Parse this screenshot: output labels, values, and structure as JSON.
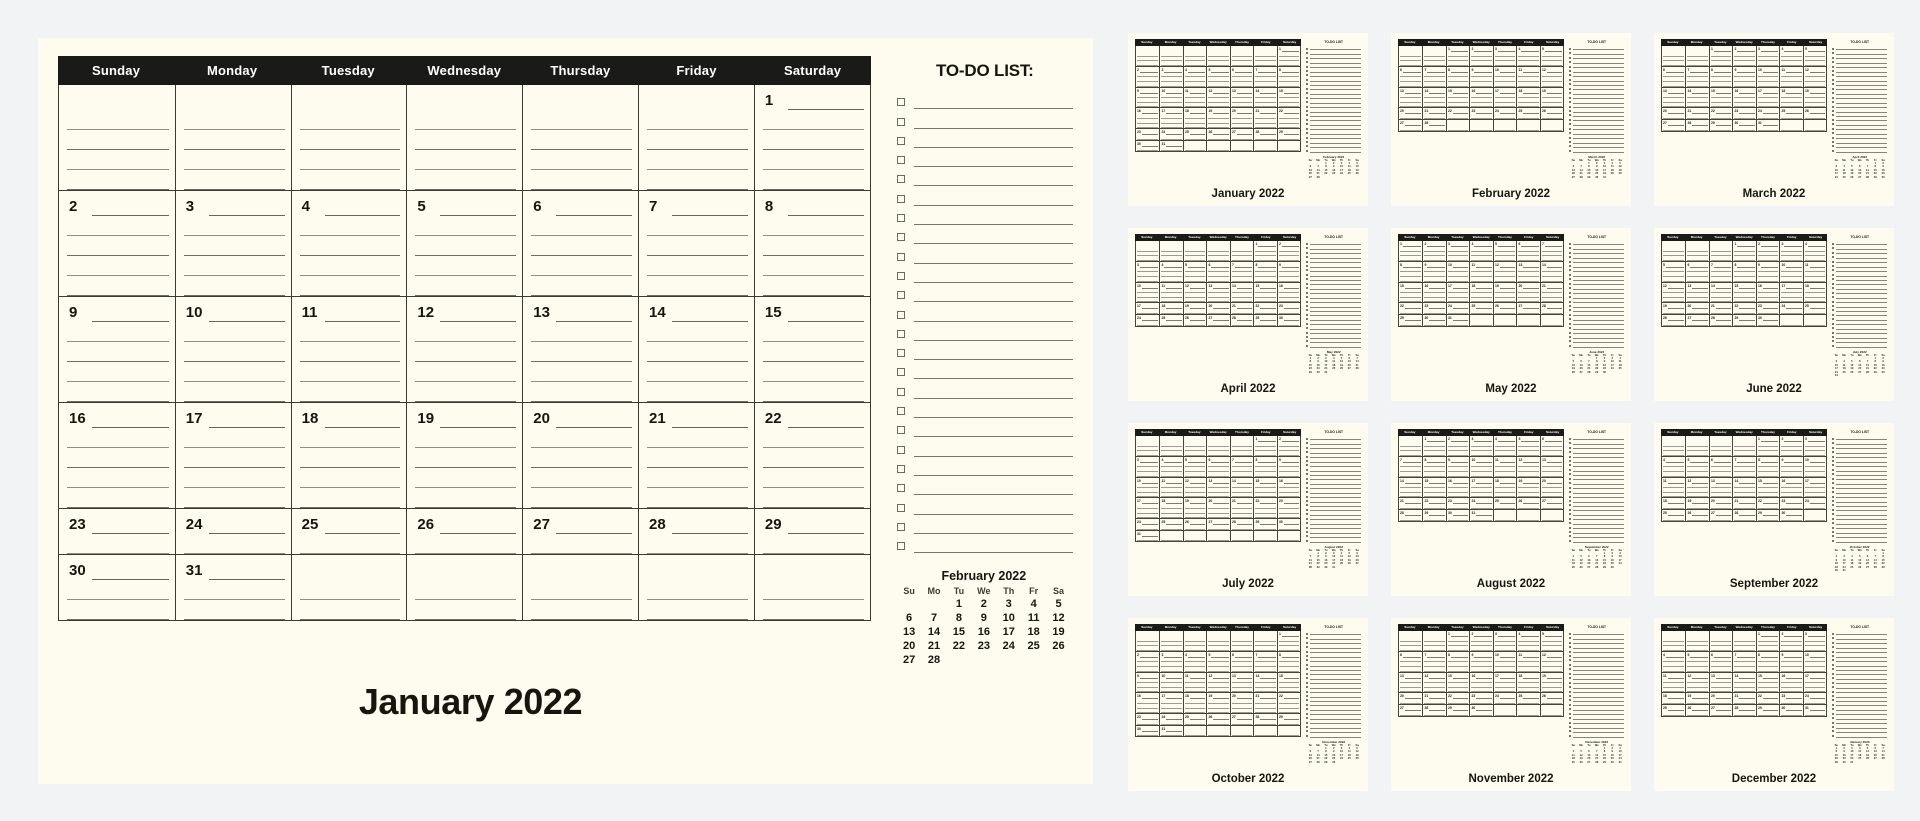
{
  "theme": {
    "page_background": "#f2f3f5",
    "card_background": "#fdfcef",
    "header_background": "#1a1a18",
    "header_text": "#ffffff",
    "ink": "#16160f",
    "rule": "#8e8e82"
  },
  "main": {
    "month_title": "January 2022",
    "day_headers": [
      "Sunday",
      "Monday",
      "Tuesday",
      "Wednesday",
      "Thursday",
      "Friday",
      "Saturday"
    ],
    "weeks": [
      {
        "days": [
          "",
          "",
          "",
          "",
          "",
          "",
          "1"
        ],
        "extra_lines": 4
      },
      {
        "days": [
          "2",
          "3",
          "4",
          "5",
          "6",
          "7",
          "8"
        ],
        "extra_lines": 4
      },
      {
        "days": [
          "9",
          "10",
          "11",
          "12",
          "13",
          "14",
          "15"
        ],
        "extra_lines": 4
      },
      {
        "days": [
          "16",
          "17",
          "18",
          "19",
          "20",
          "21",
          "22"
        ],
        "extra_lines": 4
      },
      {
        "days": [
          "23",
          "24",
          "25",
          "26",
          "27",
          "28",
          "29"
        ],
        "extra_lines": 1
      },
      {
        "days": [
          "30",
          "31",
          "",
          "",
          "",
          "",
          ""
        ],
        "extra_lines": 2
      }
    ]
  },
  "todo": {
    "title": "TO-DO LIST:",
    "row_count": 24
  },
  "mini_calendar": {
    "title": "February 2022",
    "day_headers": [
      "Su",
      "Mo",
      "Tu",
      "We",
      "Th",
      "Fr",
      "Sa"
    ],
    "leading_blanks": 2,
    "days": [
      1,
      2,
      3,
      4,
      5,
      6,
      7,
      8,
      9,
      10,
      11,
      12,
      13,
      14,
      15,
      16,
      17,
      18,
      19,
      20,
      21,
      22,
      23,
      24,
      25,
      26,
      27,
      28
    ]
  },
  "thumbnails": [
    {
      "title": "January 2022",
      "leading_blanks": 6,
      "days_in_month": 31,
      "mini_title": "February 2022",
      "mini_leading": 2,
      "mini_days": 28
    },
    {
      "title": "February 2022",
      "leading_blanks": 2,
      "days_in_month": 28,
      "mini_title": "March 2022",
      "mini_leading": 2,
      "mini_days": 31
    },
    {
      "title": "March 2022",
      "leading_blanks": 2,
      "days_in_month": 31,
      "mini_title": "April 2022",
      "mini_leading": 5,
      "mini_days": 30
    },
    {
      "title": "April 2022",
      "leading_blanks": 5,
      "days_in_month": 30,
      "mini_title": "May 2022",
      "mini_leading": 0,
      "mini_days": 31
    },
    {
      "title": "May 2022",
      "leading_blanks": 0,
      "days_in_month": 31,
      "mini_title": "June 2022",
      "mini_leading": 3,
      "mini_days": 30
    },
    {
      "title": "June 2022",
      "leading_blanks": 3,
      "days_in_month": 30,
      "mini_title": "July 2022",
      "mini_leading": 5,
      "mini_days": 31
    },
    {
      "title": "July 2022",
      "leading_blanks": 5,
      "days_in_month": 31,
      "mini_title": "August 2022",
      "mini_leading": 1,
      "mini_days": 31
    },
    {
      "title": "August 2022",
      "leading_blanks": 1,
      "days_in_month": 31,
      "mini_title": "September 2022",
      "mini_leading": 4,
      "mini_days": 30
    },
    {
      "title": "September 2022",
      "leading_blanks": 4,
      "days_in_month": 30,
      "mini_title": "October 2022",
      "mini_leading": 6,
      "mini_days": 31
    },
    {
      "title": "October 2022",
      "leading_blanks": 6,
      "days_in_month": 31,
      "mini_title": "November 2022",
      "mini_leading": 2,
      "mini_days": 30
    },
    {
      "title": "November 2022",
      "leading_blanks": 2,
      "days_in_month": 30,
      "mini_title": "December 2022",
      "mini_leading": 4,
      "mini_days": 31
    },
    {
      "title": "December 2022",
      "leading_blanks": 4,
      "days_in_month": 31,
      "mini_title": "January 2023",
      "mini_leading": 0,
      "mini_days": 31
    }
  ],
  "thumbnail_common": {
    "day_headers": [
      "Sunday",
      "Monday",
      "Tuesday",
      "Wednesday",
      "Thursday",
      "Friday",
      "Saturday"
    ],
    "todo_title": "TO-DO LIST",
    "todo_row_count": 24,
    "mini_day_headers": [
      "Su",
      "Mo",
      "Tu",
      "We",
      "Th",
      "Fr",
      "Sa"
    ]
  }
}
